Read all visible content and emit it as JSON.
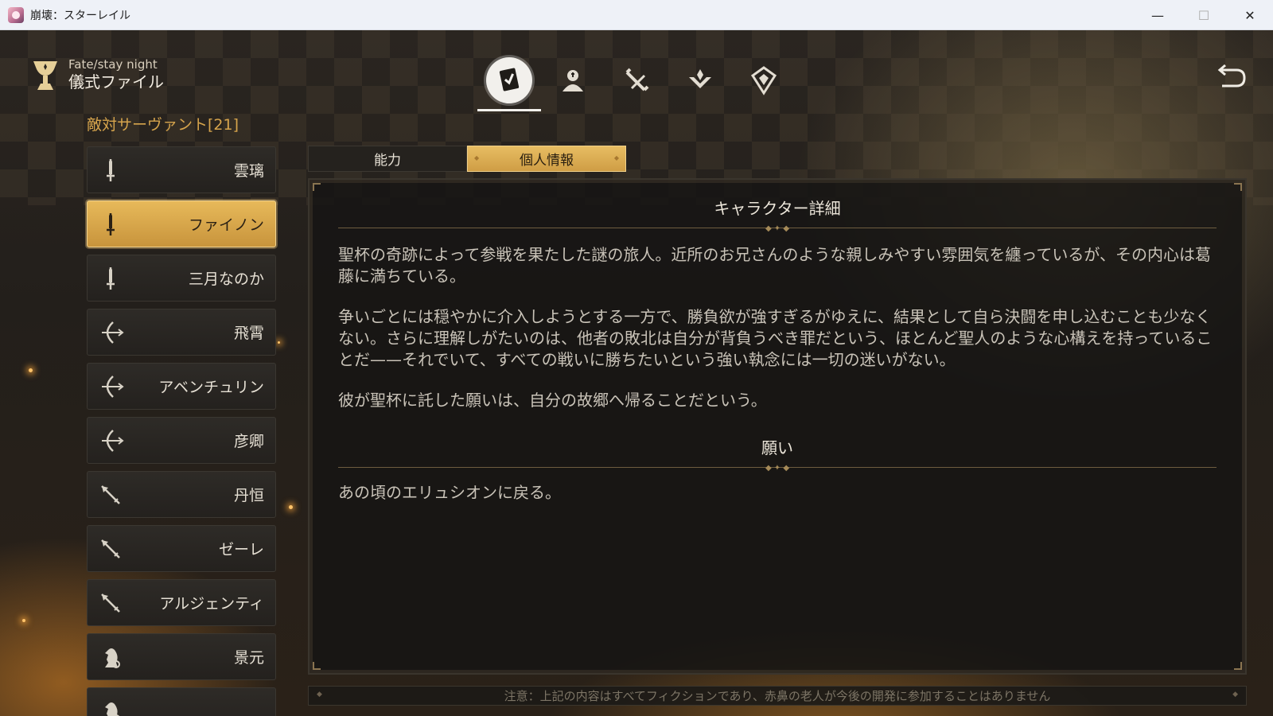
{
  "window": {
    "title": "崩壊：スターレイル",
    "minimize_glyph": "—",
    "maximize_glyph": "☐",
    "close_glyph": "✕"
  },
  "header": {
    "subtitle": "Fate/stay night",
    "title": "儀式ファイル",
    "icon": "grail-icon"
  },
  "top_nav": [
    {
      "icon": "file-card-icon",
      "active": true
    },
    {
      "icon": "servant-bust-icon",
      "active": false
    },
    {
      "icon": "sword-slash-icon",
      "active": false
    },
    {
      "icon": "chevron-emblem-icon",
      "active": false
    },
    {
      "icon": "crest-emblem-icon",
      "active": false
    }
  ],
  "list": {
    "heading": "敵対サーヴァント[21]",
    "items": [
      {
        "name": "雲璃",
        "icon": "sword-icon"
      },
      {
        "name": "ファイノン",
        "icon": "sword-icon",
        "active": true
      },
      {
        "name": "三月なのか",
        "icon": "sword-icon"
      },
      {
        "name": "飛霄",
        "icon": "bow-icon"
      },
      {
        "name": "アベンチュリン",
        "icon": "bow-icon"
      },
      {
        "name": "彦卿",
        "icon": "bow-icon"
      },
      {
        "name": "丹恒",
        "icon": "lance-icon"
      },
      {
        "name": "ゼーレ",
        "icon": "lance-icon"
      },
      {
        "name": "アルジェンティ",
        "icon": "lance-icon"
      },
      {
        "name": "景元",
        "icon": "knight-icon"
      },
      {
        "name": "",
        "icon": "knight-icon"
      }
    ]
  },
  "tabs": [
    {
      "label": "能力"
    },
    {
      "label": "個人情報",
      "active": true
    }
  ],
  "detail": {
    "title": "キャラクター詳細",
    "paragraph_1": "聖杯の奇跡によって参戦を果たした謎の旅人。近所のお兄さんのような親しみやすい雰囲気を纏っているが、その内心は葛藤に満ちている。",
    "paragraph_2": "争いごとには穏やかに介入しようとする一方で、勝負欲が強すぎるがゆえに、結果として自ら決闘を申し込むことも少なくない。さらに理解しがたいのは、他者の敗北は自分が背負うべき罪だという、ほとんど聖人のような心構えを持っていることだ——それでいて、すべての戦いに勝ちたいという強い執念には一切の迷いがない。",
    "paragraph_3": "彼が聖杯に託した願いは、自分の故郷へ帰ることだという。",
    "wish_title": "願い",
    "wish_text": "あの頃のエリュシオンに戻る。"
  },
  "footnote": "注意：上記の内容はすべてフィクションであり、赤鼻の老人が今後の開発に参加することはありません",
  "colors": {
    "accent_gold": "#d6a44c",
    "active_item_bg": "#e0b256",
    "panel_bg": "#161514"
  }
}
